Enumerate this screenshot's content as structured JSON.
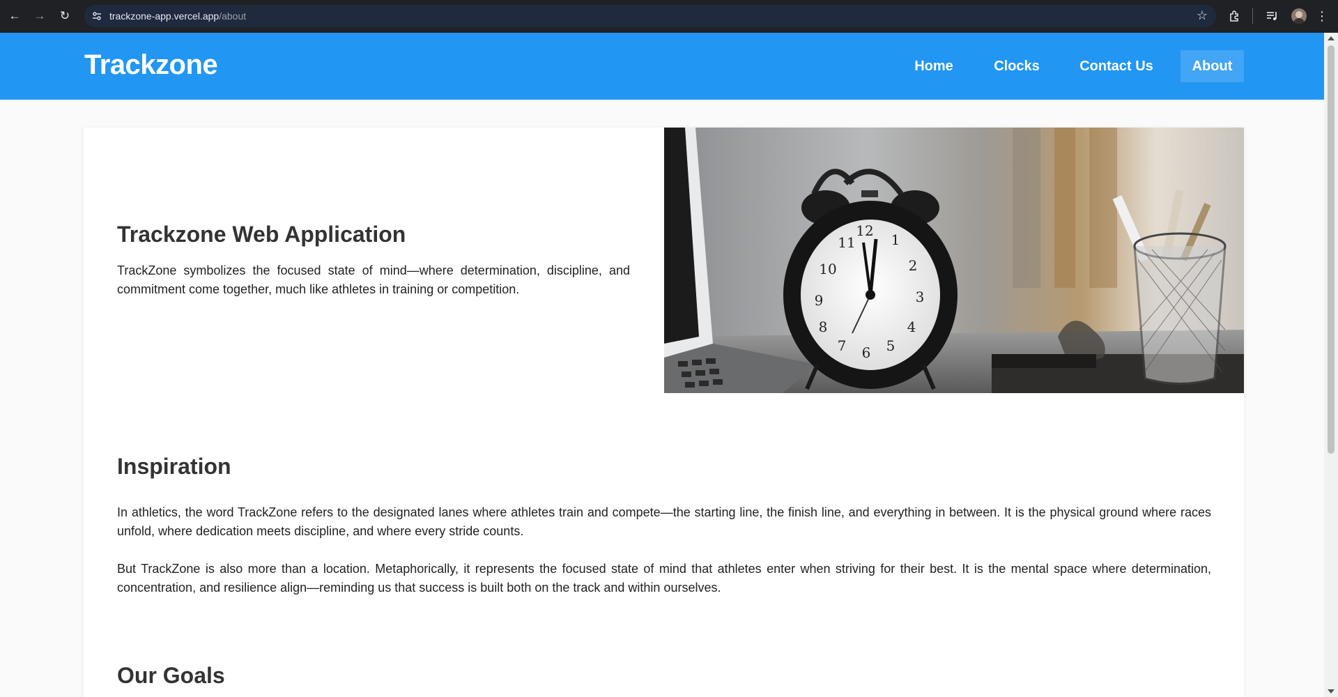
{
  "browser": {
    "url_host": "trackzone-app.vercel.app",
    "url_path": "/about"
  },
  "header": {
    "brand": "Trackzone",
    "nav": [
      {
        "label": "Home",
        "active": false
      },
      {
        "label": "Clocks",
        "active": false
      },
      {
        "label": "Contact Us",
        "active": false
      },
      {
        "label": "About",
        "active": true
      }
    ]
  },
  "hero": {
    "title": "Trackzone Web Application",
    "text": "TrackZone symbolizes the focused state of mind—where determination, discipline, and commitment come together, much like athletes in training or competition."
  },
  "inspiration": {
    "title": "Inspiration",
    "paragraphs": [
      "In athletics, the word TrackZone refers to the designated lanes where athletes train and compete—the starting line, the finish line, and everything in between. It is the physical ground where races unfold, where dedication meets discipline, and where every stride counts.",
      "But TrackZone is also more than a location. Metaphorically, it represents the focused state of mind that athletes enter when striving for their best. It is the mental space where determination, concentration, and resilience align—reminding us that success is built both on the track and within ourselves."
    ]
  },
  "goals": {
    "title": "Our Goals"
  },
  "colors": {
    "header_bg": "#2196f3",
    "nav_active_bg": "#42a5f5",
    "chrome_bg": "#202124"
  }
}
